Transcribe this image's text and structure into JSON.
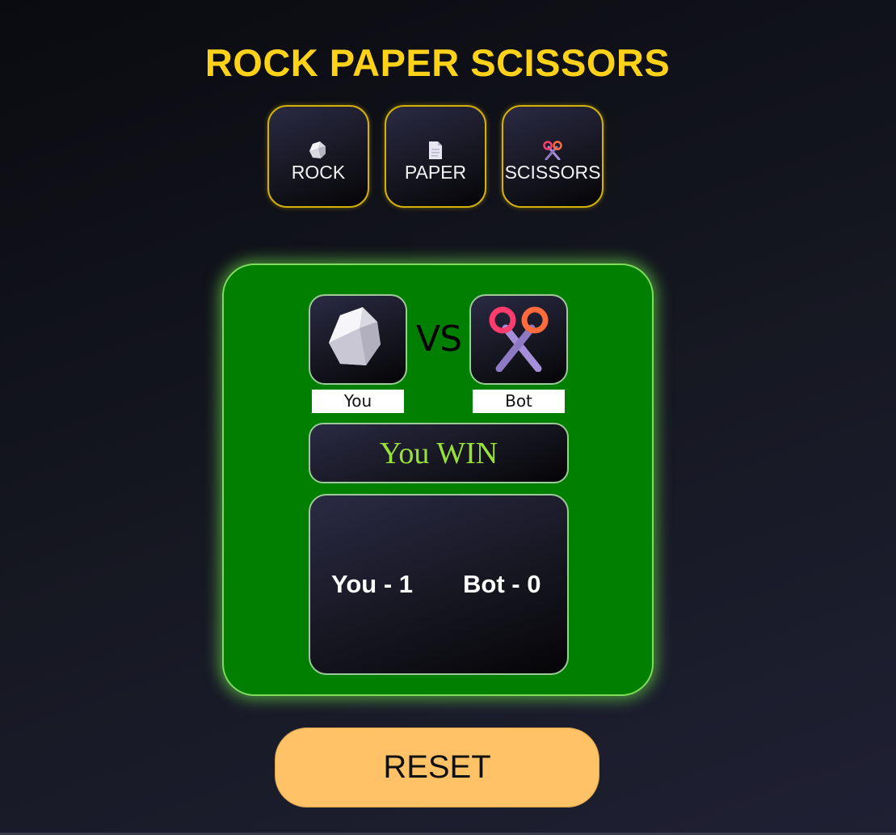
{
  "title": "ROCK PAPER SCISSORS",
  "choices": [
    {
      "label": "ROCK",
      "icon": "rock-icon"
    },
    {
      "label": "PAPER",
      "icon": "paper-icon"
    },
    {
      "label": "SCISSORS",
      "icon": "scissors-icon"
    }
  ],
  "match": {
    "you_pick_icon": "rock-icon",
    "bot_pick_icon": "scissors-icon",
    "vs": "VS",
    "you_label": "You",
    "bot_label": "Bot",
    "result": "You WIN"
  },
  "score": {
    "you": "You - 1",
    "bot": "Bot - 0"
  },
  "reset_label": "RESET",
  "colors": {
    "title": "#ffd21a",
    "panel": "#007f00",
    "result_text": "#98e03a",
    "reset_button": "#ffc266",
    "choice_border": "#d4b10a"
  }
}
